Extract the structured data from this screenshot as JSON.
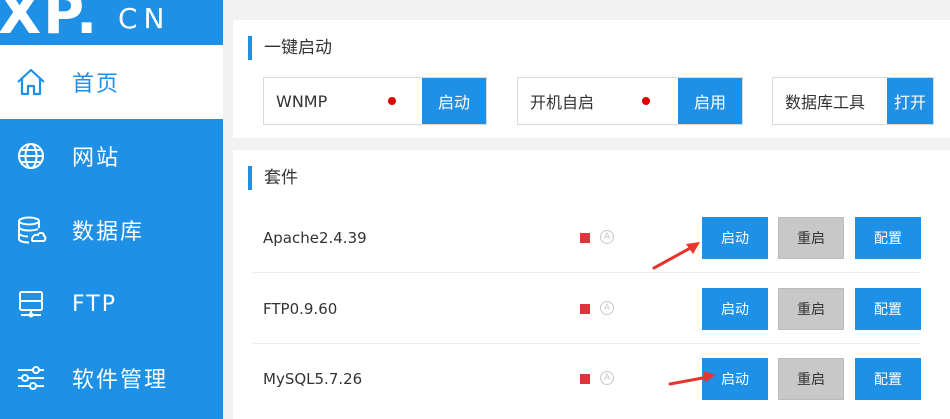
{
  "brand": {
    "logo_main": "XP.",
    "logo_sub": "CN"
  },
  "sidebar": {
    "items": [
      {
        "label": "首页",
        "icon": "home-icon",
        "active": true
      },
      {
        "label": "网站",
        "icon": "globe-icon"
      },
      {
        "label": "数据库",
        "icon": "database-icon"
      },
      {
        "label": "FTP",
        "icon": "ftp-server-icon"
      },
      {
        "label": "软件管理",
        "icon": "sliders-icon"
      }
    ]
  },
  "quick_start": {
    "title": "一键启动",
    "groups": [
      {
        "label": "WNMP",
        "button": "启动",
        "status_dot": true
      },
      {
        "label": "开机自启",
        "button": "启用",
        "status_dot": true
      },
      {
        "label": "数据库工具",
        "button": "打开",
        "status_dot": false
      }
    ]
  },
  "suite": {
    "title": "套件",
    "rows": [
      {
        "name": "Apache2.4.39",
        "start": "启动",
        "restart": "重启",
        "config": "配置",
        "auto": "A"
      },
      {
        "name": "FTP0.9.60",
        "start": "启动",
        "restart": "重启",
        "config": "配置",
        "auto": "A"
      },
      {
        "name": "MySQL5.7.26",
        "start": "启动",
        "restart": "重启",
        "config": "配置",
        "auto": "A"
      }
    ]
  },
  "colors": {
    "primary": "#1e90e6",
    "sidebar": "#1e90e6",
    "status_red": "#d9363e",
    "arrow": "#e8342e",
    "restart_gray": "#c8c8c8"
  }
}
